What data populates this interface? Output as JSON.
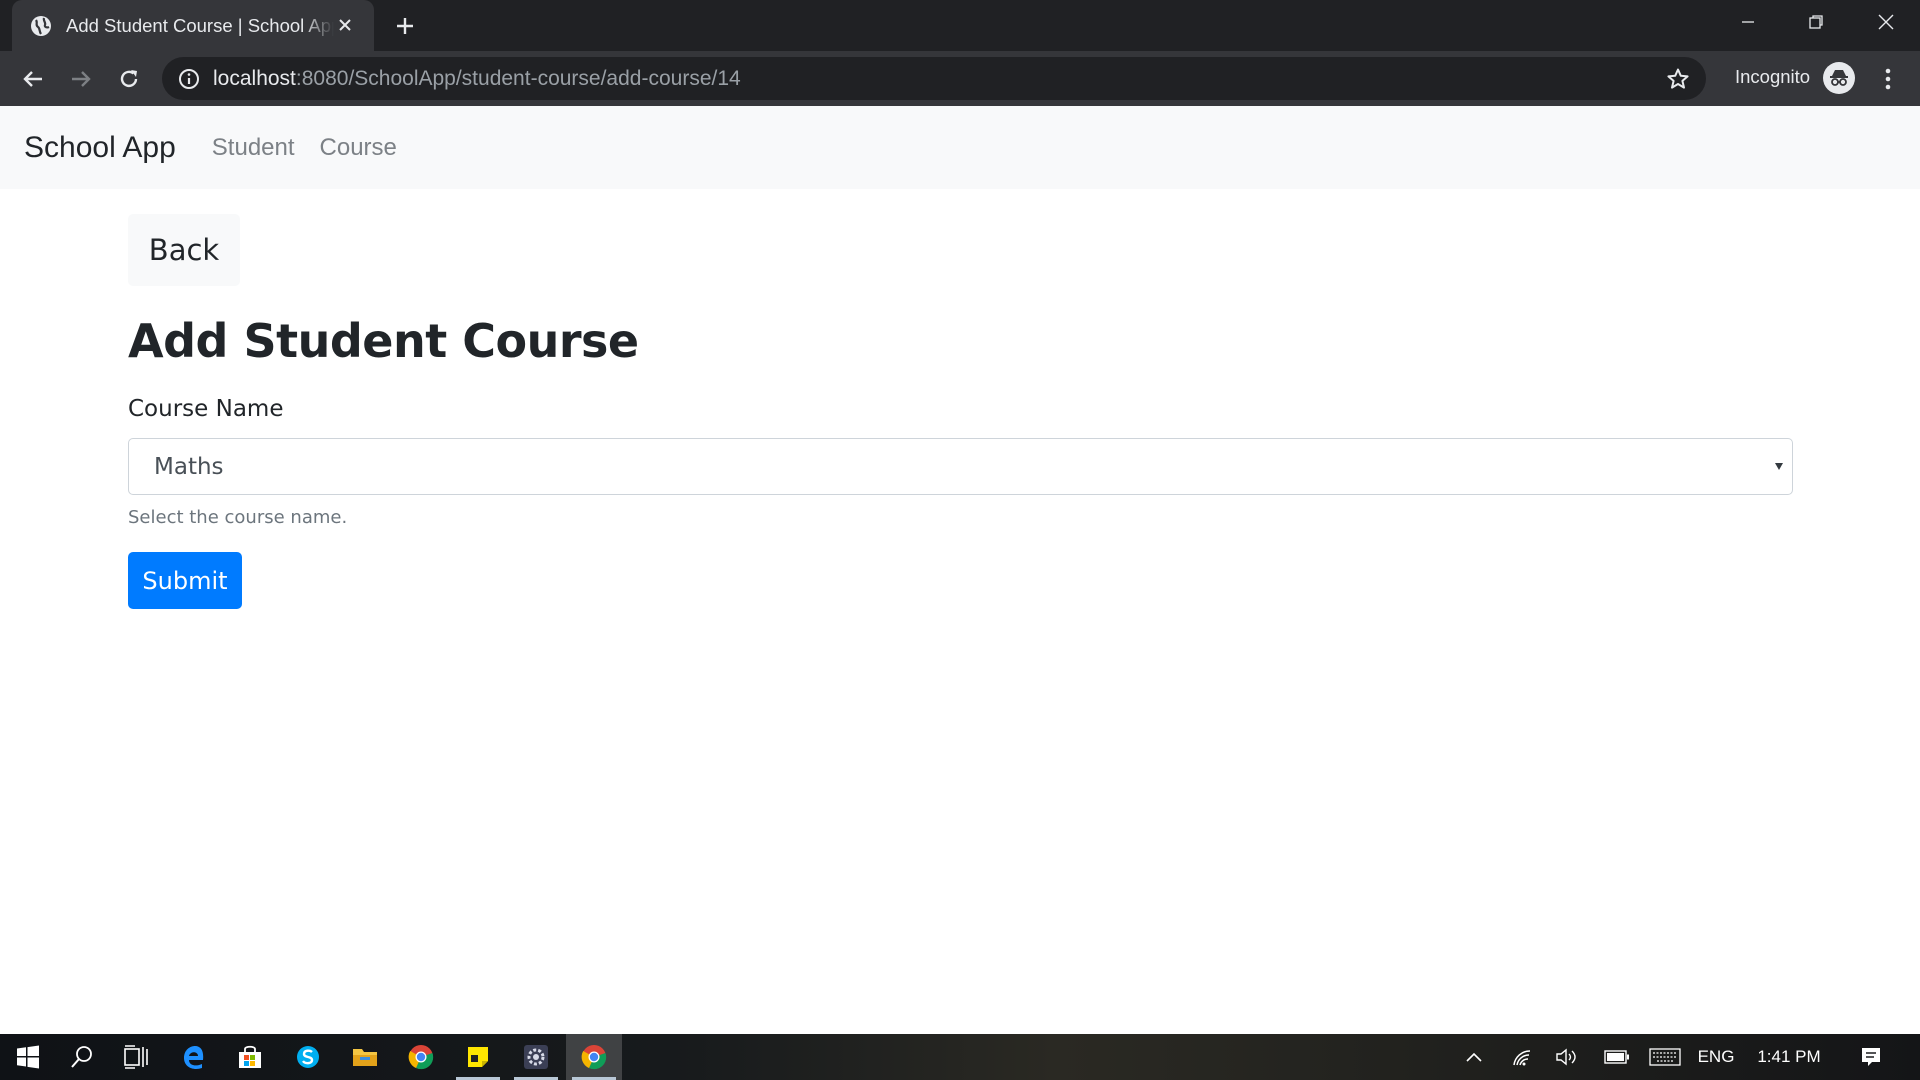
{
  "browser": {
    "tab_title": "Add Student Course | School App",
    "url_host": "localhost",
    "url_rest": ":8080/SchoolApp/student-course/add-course/14",
    "profile_label": "Incognito"
  },
  "app": {
    "brand": "School App",
    "nav": [
      {
        "label": "Student"
      },
      {
        "label": "Course"
      }
    ]
  },
  "form": {
    "back_label": "Back",
    "title": "Add Student Course",
    "course_label": "Course Name",
    "course_value": "Maths",
    "course_help": "Select the course name.",
    "submit_label": "Submit"
  },
  "taskbar": {
    "language": "ENG",
    "time": "1:41 PM"
  },
  "colors": {
    "primary": "#007bff",
    "navbar_bg": "#f8f9fa",
    "chrome_dark": "#202124",
    "chrome_toolbar": "#35363a"
  }
}
